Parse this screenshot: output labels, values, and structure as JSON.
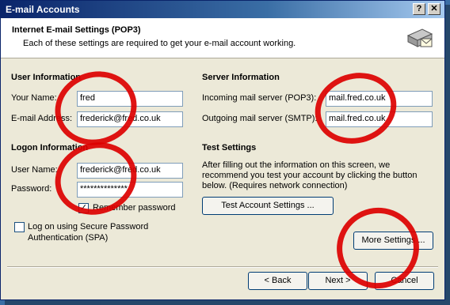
{
  "window": {
    "title": "E-mail Accounts",
    "help_glyph": "?",
    "close_glyph": "✕"
  },
  "header": {
    "title": "Internet E-mail Settings (POP3)",
    "subtitle": "Each of these settings are required to get your e-mail account working."
  },
  "user_info": {
    "heading": "User Information",
    "name_label": "Your Name:",
    "name_value": "fred",
    "email_label": "E-mail Address:",
    "email_value": "frederick@fred.co.uk"
  },
  "server_info": {
    "heading": "Server Information",
    "incoming_label": "Incoming mail server (POP3):",
    "incoming_value": "mail.fred.co.uk",
    "outgoing_label": "Outgoing mail server (SMTP):",
    "outgoing_value": "mail.fred.co.uk"
  },
  "logon_info": {
    "heading": "Logon Information",
    "username_label": "User Name:",
    "username_value": "frederick@fred.co.uk",
    "password_label": "Password:",
    "password_value": "**************",
    "remember_label": "Remember password",
    "remember_checked": true,
    "spa_label_1": "Log on using Secure Password",
    "spa_label_2": "Authentication (SPA)",
    "spa_checked": false
  },
  "test_settings": {
    "heading": "Test Settings",
    "text_1": "After filling out the information on this screen, we",
    "text_2": "recommend you test your account by clicking the button",
    "text_3": "below. (Requires network connection)",
    "test_button": "Test Account Settings ..."
  },
  "buttons": {
    "more_settings": "More Settings ...",
    "back": "< Back",
    "next": "Next >",
    "cancel": "Cancel"
  },
  "colors": {
    "title_bar": "#0a246a",
    "dialog_bg": "#ece9d8",
    "annotation_circles": "#dc0000"
  }
}
